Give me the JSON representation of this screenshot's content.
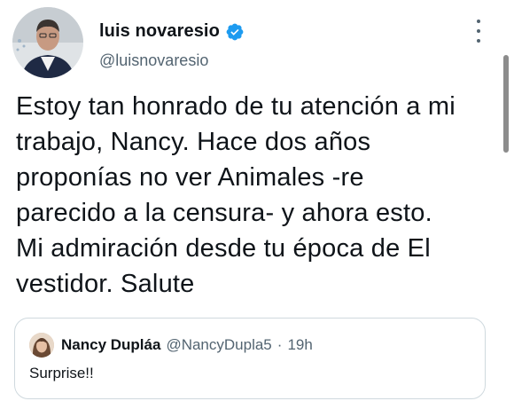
{
  "author": {
    "display_name": "luis novaresio",
    "handle": "@luisnovaresio",
    "verified": true
  },
  "tweet": {
    "text": "Estoy tan honrado de tu atención a mi\ntrabajo, Nancy.  Hace dos años\nproponías no ver Animales -re\nparecido a la censura- y ahora esto.\nMi admiración desde tu época de El\nvestidor.   Salute"
  },
  "quoted_tweet": {
    "display_name": "Nancy Dupláa",
    "handle": "@NancyDupla5",
    "separator": "·",
    "time": "19h",
    "text": "Surprise!!"
  },
  "colors": {
    "text_primary": "#0f1419",
    "text_secondary": "#536471",
    "verified_blue": "#1d9bf0",
    "border": "#cfd9de"
  },
  "icons": {
    "verified": "verified-badge-icon",
    "more": "more-options-icon"
  }
}
